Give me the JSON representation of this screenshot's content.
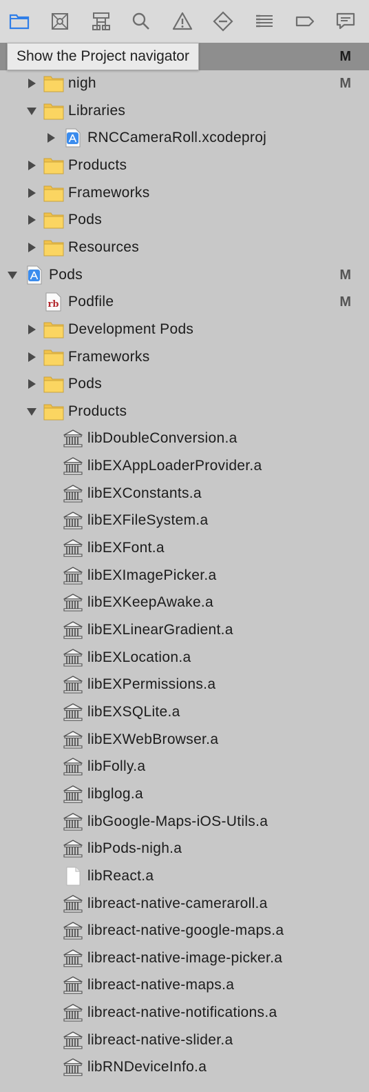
{
  "toolbar": {
    "buttons": [
      {
        "name": "project-navigator-button",
        "icon": "folder-icon",
        "active": true
      },
      {
        "name": "source-control-navigator-button",
        "icon": "source-control-icon"
      },
      {
        "name": "symbol-navigator-button",
        "icon": "hierarchy-icon"
      },
      {
        "name": "find-navigator-button",
        "icon": "search-icon"
      },
      {
        "name": "issue-navigator-button",
        "icon": "warning-icon"
      },
      {
        "name": "test-navigator-button",
        "icon": "diamond-icon"
      },
      {
        "name": "debug-navigator-button",
        "icon": "list-icon"
      },
      {
        "name": "breakpoint-navigator-button",
        "icon": "breakpoint-icon"
      },
      {
        "name": "report-navigator-button",
        "icon": "speech-bubble-icon"
      }
    ],
    "accent_color": "#2f7ee8"
  },
  "tooltip": {
    "text": "Show the Project navigator"
  },
  "selected_row": {
    "badge": "M"
  },
  "tree": [
    {
      "label": "nigh",
      "icon": "folder-icon",
      "level": 1,
      "expanded": false,
      "badge": "M"
    },
    {
      "label": "Libraries",
      "icon": "folder-icon",
      "level": 1,
      "expanded": true,
      "badge": ""
    },
    {
      "label": "RNCCameraRoll.xcodeproj",
      "icon": "xcodeproj-icon",
      "level": 2,
      "expanded": false,
      "badge": ""
    },
    {
      "label": "Products",
      "icon": "folder-icon",
      "level": 1,
      "expanded": false,
      "badge": ""
    },
    {
      "label": "Frameworks",
      "icon": "folder-icon",
      "level": 1,
      "expanded": false,
      "badge": ""
    },
    {
      "label": "Pods",
      "icon": "folder-icon",
      "level": 1,
      "expanded": false,
      "badge": ""
    },
    {
      "label": "Resources",
      "icon": "folder-icon",
      "level": 1,
      "expanded": false,
      "badge": ""
    },
    {
      "label": "Pods",
      "icon": "xcodeproj-icon",
      "level": 0,
      "expanded": true,
      "badge": "M"
    },
    {
      "label": "Podfile",
      "icon": "ruby-file-icon",
      "level": 1,
      "expanded": null,
      "badge": "M"
    },
    {
      "label": "Development Pods",
      "icon": "folder-icon",
      "level": 1,
      "expanded": false,
      "badge": ""
    },
    {
      "label": "Frameworks",
      "icon": "folder-icon",
      "level": 1,
      "expanded": false,
      "badge": ""
    },
    {
      "label": "Pods",
      "icon": "folder-icon",
      "level": 1,
      "expanded": false,
      "badge": ""
    },
    {
      "label": "Products",
      "icon": "folder-icon",
      "level": 1,
      "expanded": true,
      "badge": ""
    },
    {
      "label": "libDoubleConversion.a",
      "icon": "library-icon",
      "level": 2,
      "expanded": null,
      "badge": ""
    },
    {
      "label": "libEXAppLoaderProvider.a",
      "icon": "library-icon",
      "level": 2,
      "expanded": null,
      "badge": ""
    },
    {
      "label": "libEXConstants.a",
      "icon": "library-icon",
      "level": 2,
      "expanded": null,
      "badge": ""
    },
    {
      "label": "libEXFileSystem.a",
      "icon": "library-icon",
      "level": 2,
      "expanded": null,
      "badge": ""
    },
    {
      "label": "libEXFont.a",
      "icon": "library-icon",
      "level": 2,
      "expanded": null,
      "badge": ""
    },
    {
      "label": "libEXImagePicker.a",
      "icon": "library-icon",
      "level": 2,
      "expanded": null,
      "badge": ""
    },
    {
      "label": "libEXKeepAwake.a",
      "icon": "library-icon",
      "level": 2,
      "expanded": null,
      "badge": ""
    },
    {
      "label": "libEXLinearGradient.a",
      "icon": "library-icon",
      "level": 2,
      "expanded": null,
      "badge": ""
    },
    {
      "label": "libEXLocation.a",
      "icon": "library-icon",
      "level": 2,
      "expanded": null,
      "badge": ""
    },
    {
      "label": "libEXPermissions.a",
      "icon": "library-icon",
      "level": 2,
      "expanded": null,
      "badge": ""
    },
    {
      "label": "libEXSQLite.a",
      "icon": "library-icon",
      "level": 2,
      "expanded": null,
      "badge": ""
    },
    {
      "label": "libEXWebBrowser.a",
      "icon": "library-icon",
      "level": 2,
      "expanded": null,
      "badge": ""
    },
    {
      "label": "libFolly.a",
      "icon": "library-icon",
      "level": 2,
      "expanded": null,
      "badge": ""
    },
    {
      "label": "libglog.a",
      "icon": "library-icon",
      "level": 2,
      "expanded": null,
      "badge": ""
    },
    {
      "label": "libGoogle-Maps-iOS-Utils.a",
      "icon": "library-icon",
      "level": 2,
      "expanded": null,
      "badge": ""
    },
    {
      "label": "libPods-nigh.a",
      "icon": "library-icon",
      "level": 2,
      "expanded": null,
      "badge": ""
    },
    {
      "label": "libReact.a",
      "icon": "blank-file-icon",
      "level": 2,
      "expanded": null,
      "badge": ""
    },
    {
      "label": "libreact-native-cameraroll.a",
      "icon": "library-icon",
      "level": 2,
      "expanded": null,
      "badge": ""
    },
    {
      "label": "libreact-native-google-maps.a",
      "icon": "library-icon",
      "level": 2,
      "expanded": null,
      "badge": ""
    },
    {
      "label": "libreact-native-image-picker.a",
      "icon": "library-icon",
      "level": 2,
      "expanded": null,
      "badge": ""
    },
    {
      "label": "libreact-native-maps.a",
      "icon": "library-icon",
      "level": 2,
      "expanded": null,
      "badge": ""
    },
    {
      "label": "libreact-native-notifications.a",
      "icon": "library-icon",
      "level": 2,
      "expanded": null,
      "badge": ""
    },
    {
      "label": "libreact-native-slider.a",
      "icon": "library-icon",
      "level": 2,
      "expanded": null,
      "badge": ""
    },
    {
      "label": "libRNDeviceInfo.a",
      "icon": "library-icon",
      "level": 2,
      "expanded": null,
      "badge": ""
    }
  ]
}
